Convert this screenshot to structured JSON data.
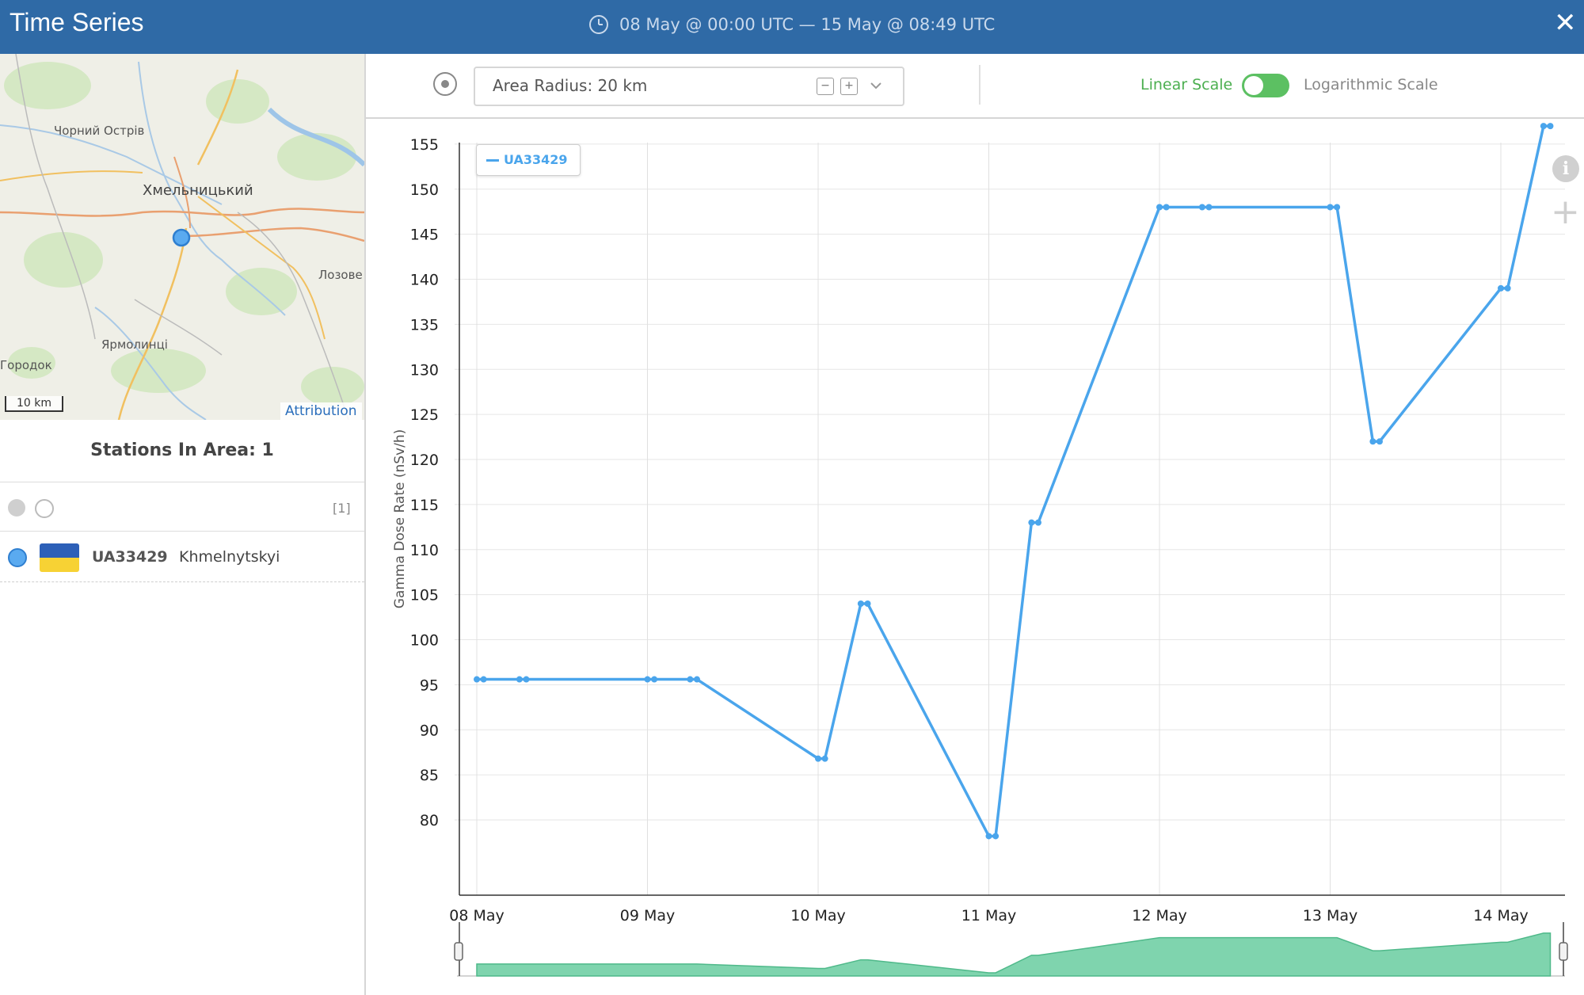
{
  "header": {
    "title": "Time Series",
    "date_range": "08 May @ 00:00 UTC  —  15 May @ 08:49 UTC",
    "close_icon": "close-icon"
  },
  "map": {
    "labels": {
      "chornyi_ostriv": "Чорний Острів",
      "khmelnytskyi": "Хмельницький",
      "lozove": "Лозове",
      "yarmolyntsi": "Ярмолинці",
      "horodok": "Городок"
    },
    "scale_label": "10 km",
    "attribution": "Attribution"
  },
  "stations": {
    "title": "Stations In Area: 1",
    "count_badge": "[1]",
    "items": [
      {
        "id": "UA33429",
        "name": "Khmelnytskyi",
        "flag": "ukraine-flag-icon",
        "color": "#5aaaf0"
      }
    ]
  },
  "toolbar": {
    "radius_label": "Area Radius: 20 km",
    "linear_label": "Linear Scale",
    "log_label": "Logarithmic Scale",
    "scale_mode": "linear",
    "minus_icon": "minus-box-icon",
    "plus_icon": "plus-box-icon",
    "chevron_icon": "chevron-down-icon"
  },
  "colors": {
    "header": "#2f6aa6",
    "series": "#4aa5ec",
    "navigator_fill": "#7fd4ae",
    "toggle_on": "#5cc062"
  },
  "chart_data": {
    "type": "line",
    "ylabel": "Gamma Dose Rate (nSv/h)",
    "xlabel": "",
    "ylim": [
      80,
      155
    ],
    "x_ticks": [
      "08 May",
      "09 May",
      "10 May",
      "11 May",
      "12 May",
      "13 May",
      "14 May"
    ],
    "y_ticks": [
      80,
      85,
      90,
      95,
      100,
      105,
      110,
      115,
      120,
      125,
      130,
      135,
      140,
      145,
      150,
      155
    ],
    "legend": "top-left",
    "grid": true,
    "series": [
      {
        "name": "UA33429",
        "points": [
          {
            "x": 0.0,
            "y": 95.6
          },
          {
            "x": 0.04,
            "y": 95.6
          },
          {
            "x": 0.25,
            "y": 95.6
          },
          {
            "x": 0.29,
            "y": 95.6
          },
          {
            "x": 1.0,
            "y": 95.6
          },
          {
            "x": 1.04,
            "y": 95.6
          },
          {
            "x": 1.25,
            "y": 95.6
          },
          {
            "x": 1.29,
            "y": 95.6
          },
          {
            "x": 2.0,
            "y": 86.8
          },
          {
            "x": 2.04,
            "y": 86.8
          },
          {
            "x": 2.25,
            "y": 104.0
          },
          {
            "x": 2.29,
            "y": 104.0
          },
          {
            "x": 3.0,
            "y": 78.2
          },
          {
            "x": 3.04,
            "y": 78.2
          },
          {
            "x": 3.25,
            "y": 113.0
          },
          {
            "x": 3.29,
            "y": 113.0
          },
          {
            "x": 4.0,
            "y": 148.0
          },
          {
            "x": 4.04,
            "y": 148.0
          },
          {
            "x": 4.25,
            "y": 148.0
          },
          {
            "x": 4.29,
            "y": 148.0
          },
          {
            "x": 5.0,
            "y": 148.0
          },
          {
            "x": 5.04,
            "y": 148.0
          },
          {
            "x": 5.25,
            "y": 122.0
          },
          {
            "x": 5.29,
            "y": 122.0
          },
          {
            "x": 6.0,
            "y": 139.0
          },
          {
            "x": 6.04,
            "y": 139.0
          },
          {
            "x": 6.25,
            "y": 157.0
          },
          {
            "x": 6.29,
            "y": 157.0
          }
        ]
      }
    ]
  }
}
